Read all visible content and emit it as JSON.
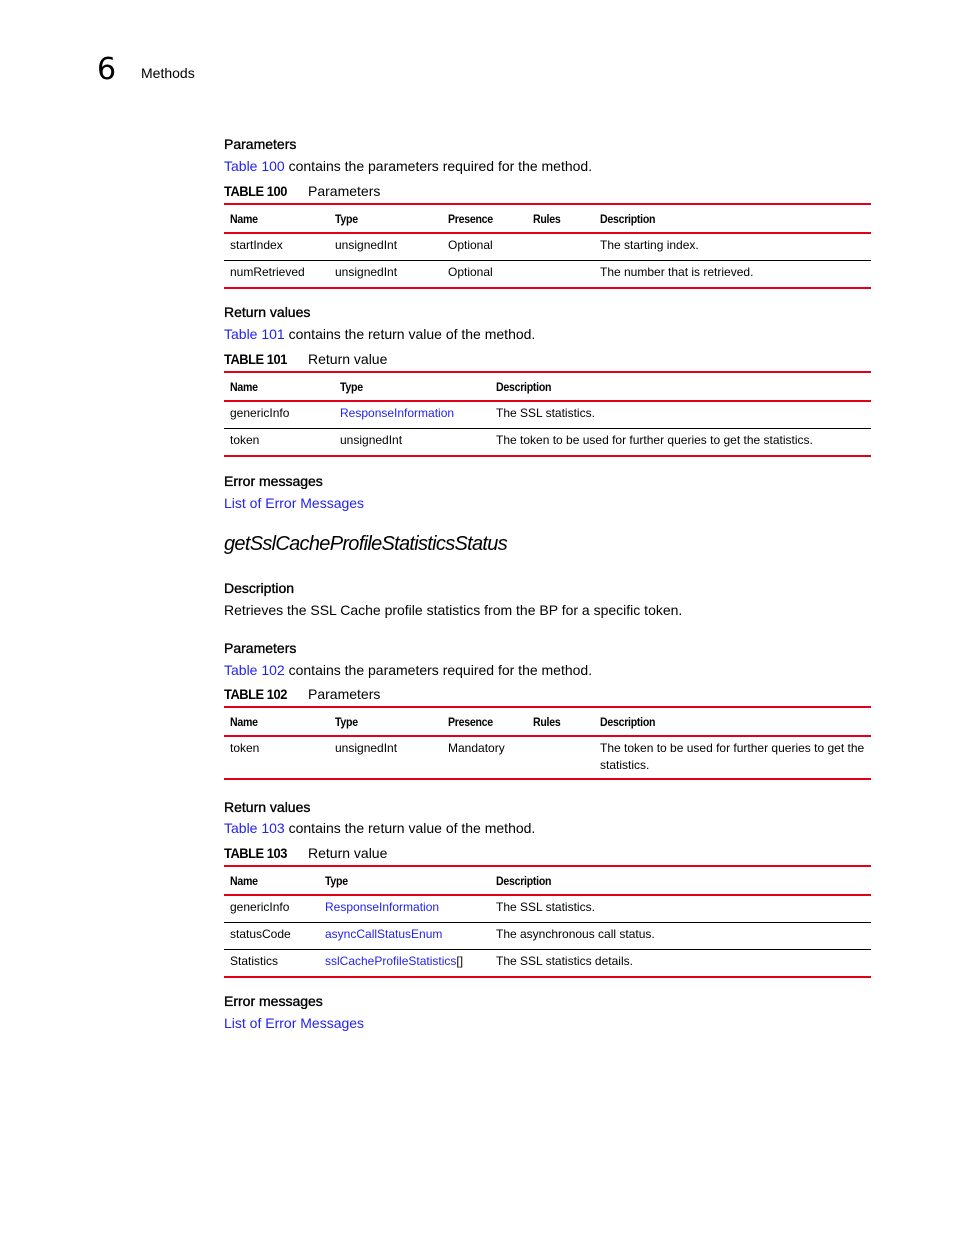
{
  "header": {
    "chapter_number": "6",
    "chapter_title": "Methods"
  },
  "block1": {
    "parameters": {
      "heading": "Parameters",
      "intro_link": "Table 100",
      "intro_text": " contains the parameters required for the method.",
      "caption_label": "TABLE 100",
      "caption_title": "Parameters",
      "columns": [
        "Name",
        "Type",
        "Presence",
        "Rules",
        "Description"
      ],
      "rows": [
        [
          "startIndex",
          "unsignedInt",
          "Optional",
          "",
          "The starting index."
        ],
        [
          "numRetrieved",
          "unsignedInt",
          "Optional",
          "",
          "The number that is retrieved."
        ]
      ]
    },
    "return_values": {
      "heading": "Return values",
      "intro_link": "Table 101",
      "intro_text": " contains the return value of the method.",
      "caption_label": "TABLE 101",
      "caption_title": "Return value",
      "columns": [
        "Name",
        "Type",
        "Description"
      ],
      "rows": [
        {
          "name": "genericInfo",
          "type": "ResponseInformation",
          "type_is_link": true,
          "type_suffix": "",
          "description": "The SSL statistics."
        },
        {
          "name": "token",
          "type": "unsignedInt",
          "type_is_link": false,
          "type_suffix": "",
          "description": "The token to be used for further queries to get the statistics."
        }
      ]
    },
    "errors": {
      "heading": "Error messages",
      "link": "List of Error Messages"
    }
  },
  "method": {
    "title": "getSslCacheProfileStatisticsStatus",
    "description_heading": "Description",
    "description_text": "Retrieves the SSL Cache profile statistics from the BP for a specific token.",
    "parameters": {
      "heading": "Parameters",
      "intro_link": "Table 102",
      "intro_text": " contains the parameters required for the method.",
      "caption_label": "TABLE 102",
      "caption_title": "Parameters",
      "columns": [
        "Name",
        "Type",
        "Presence",
        "Rules",
        "Description"
      ],
      "rows": [
        [
          "token",
          "unsignedInt",
          "Mandatory",
          "",
          "The token to be used for further queries to get the statistics."
        ]
      ]
    },
    "return_values": {
      "heading": "Return values",
      "intro_link": "Table 103",
      "intro_text": " contains the return value of the method.",
      "caption_label": "TABLE 103",
      "caption_title": "Return value",
      "columns": [
        "Name",
        "Type",
        "Description"
      ],
      "rows": [
        {
          "name": "genericInfo",
          "type": "ResponseInformation",
          "type_is_link": true,
          "type_suffix": "",
          "description": "The SSL statistics."
        },
        {
          "name": "statusCode",
          "type": "asyncCallStatusEnum",
          "type_is_link": true,
          "type_suffix": "",
          "description": "The asynchronous call status."
        },
        {
          "name": "Statistics",
          "type": "sslCacheProfileStatistics",
          "type_is_link": true,
          "type_suffix": "[]",
          "description": "The SSL statistics details."
        }
      ]
    },
    "errors": {
      "heading": "Error messages",
      "link": "List of Error Messages"
    }
  },
  "colors": {
    "rule_red": "#e3001b",
    "link_blue": "#2222ee"
  }
}
